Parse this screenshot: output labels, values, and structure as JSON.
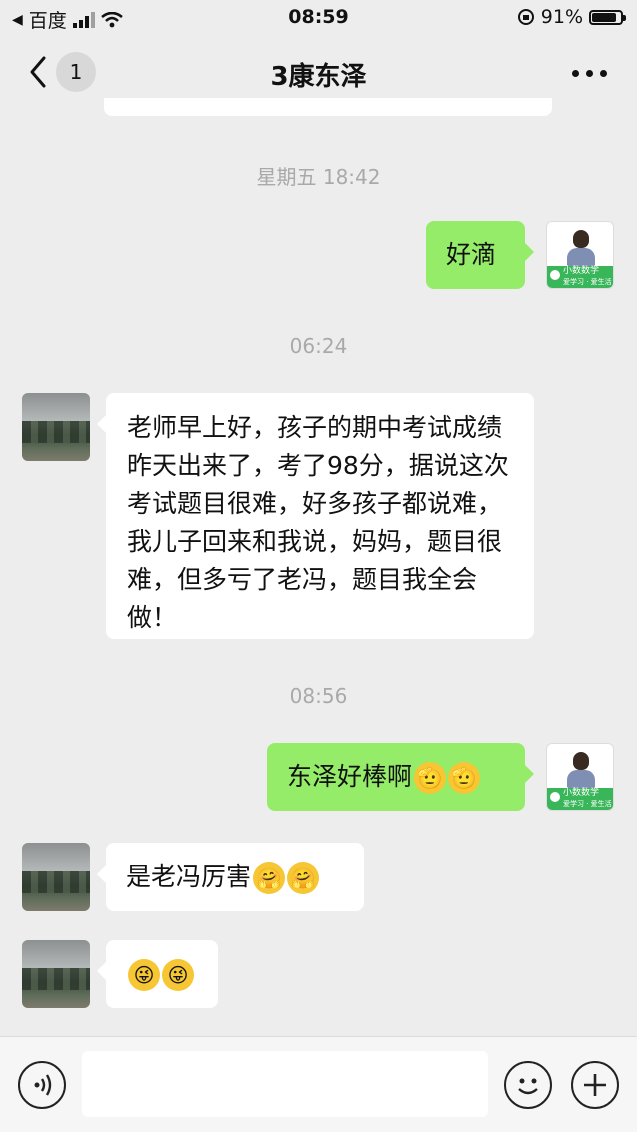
{
  "status_bar": {
    "carrier": "百度",
    "time": "08:59",
    "battery": "91%",
    "battery_level": 0.91
  },
  "nav": {
    "unread_count": "1",
    "title": "3康东泽"
  },
  "messages": [
    {
      "type": "timestamp",
      "text": "星期五 18:42"
    },
    {
      "type": "out",
      "text": "好滴"
    },
    {
      "type": "timestamp",
      "text": "06:24"
    },
    {
      "type": "in",
      "text": "老师早上好，孩子的期中考试成绩昨天出来了，考了98分，据说这次考试题目很难，好多孩子都说难，我儿子回来和我说，妈妈，题目很难，但多亏了老冯，题目我全会做！"
    },
    {
      "type": "timestamp",
      "text": "08:56"
    },
    {
      "type": "out",
      "text": "东泽好棒啊",
      "emojis": [
        "salute-emoji",
        "salute-emoji"
      ]
    },
    {
      "type": "in",
      "text": "是老冯厉害",
      "emojis": [
        "grinning-hands-emoji",
        "grinning-hands-emoji"
      ]
    },
    {
      "type": "in",
      "text": "",
      "emojis": [
        "tongue-wink-emoji",
        "tongue-wink-emoji"
      ]
    }
  ],
  "teacher_avatar": {
    "brand": "小数数学",
    "tagline": "爱学习 · 爱生活"
  },
  "input_bar": {
    "placeholder": ""
  },
  "icons": {
    "voice": "voice-icon",
    "emoji": "emoji-icon",
    "add": "plus-icon"
  }
}
